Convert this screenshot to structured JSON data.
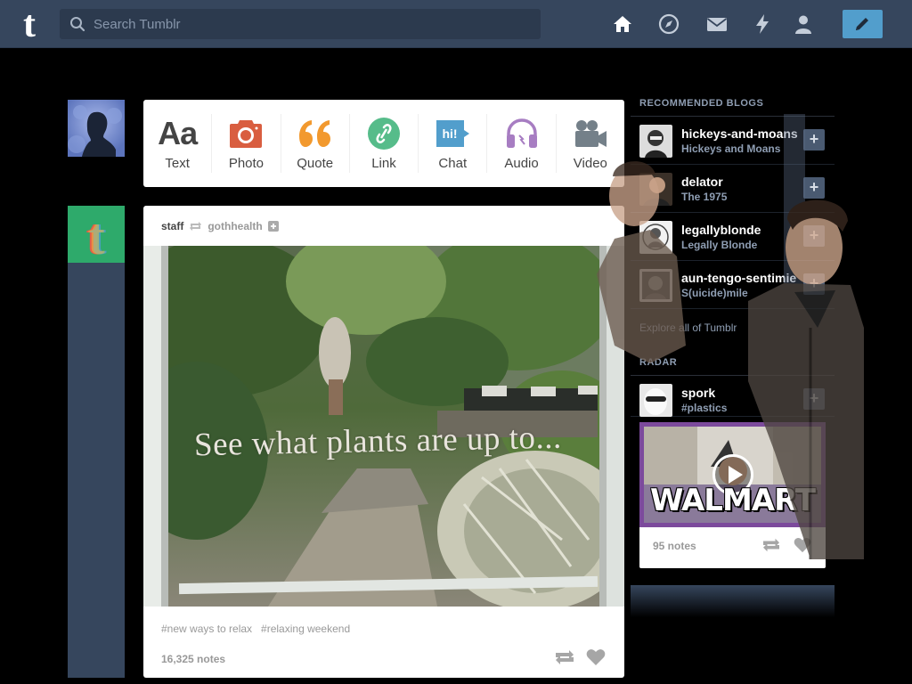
{
  "header": {
    "search_placeholder": "Search Tumblr",
    "nav_icons": [
      "home-icon",
      "explore-icon",
      "inbox-icon",
      "activity-icon",
      "account-icon"
    ],
    "compose_icon": "pencil-icon"
  },
  "post_types": [
    {
      "label": "Text",
      "icon": "text-icon",
      "glyph": "Aa",
      "color": "#444444"
    },
    {
      "label": "Photo",
      "icon": "camera-icon",
      "color": "#d95e40"
    },
    {
      "label": "Quote",
      "icon": "quote-icon",
      "color": "#f2992e"
    },
    {
      "label": "Link",
      "icon": "link-icon",
      "color": "#56bc8a"
    },
    {
      "label": "Chat",
      "icon": "chat-icon",
      "glyph": "hi!",
      "color": "#529ecc"
    },
    {
      "label": "Audio",
      "icon": "headphones-icon",
      "color": "#a77dc2"
    },
    {
      "label": "Video",
      "icon": "video-camera-icon",
      "color": "#748089"
    }
  ],
  "post": {
    "author": "staff",
    "reblogged_from": "gothhealth",
    "image_caption": "See what plants are up to...",
    "tags": [
      "#new ways to relax",
      "#relaxing weekend"
    ],
    "notes": "16,325 notes"
  },
  "sidebar": {
    "recommended_title": "RECOMMENDED BLOGS",
    "blogs": [
      {
        "name": "hickeys-and-moans",
        "title": "Hickeys and Moans"
      },
      {
        "name": "delator",
        "title": "The 1975"
      },
      {
        "name": "legallyblonde",
        "title": "Legally Blonde"
      },
      {
        "name": "aun-tengo-sentimie",
        "title": "S(uicide)mile"
      }
    ],
    "explore_link": "Explore all of Tumblr",
    "radar_title": "RADAR",
    "radar_blog": {
      "name": "spork",
      "title": "#plastics"
    },
    "radar_image_text": "WALMART",
    "radar_notes": "95 notes"
  },
  "colors": {
    "topbar": "#36465d",
    "accent": "#529ecc",
    "background": "#000000"
  }
}
